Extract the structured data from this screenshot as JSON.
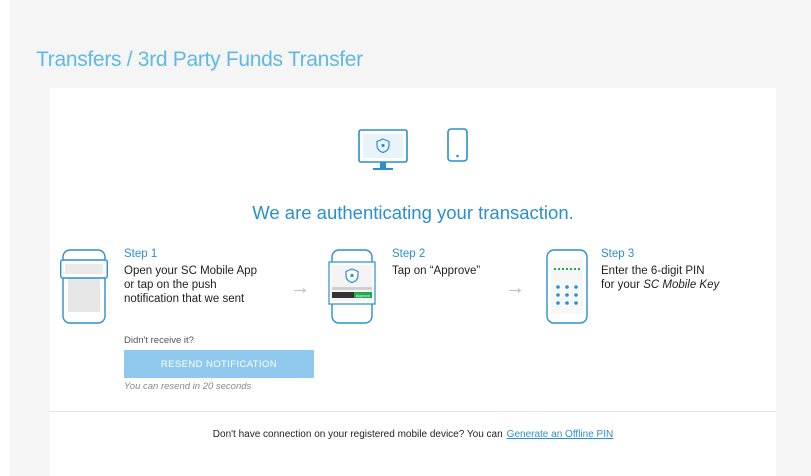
{
  "header": {
    "breadcrumb": "Transfers / 3rd Party Funds Transfer"
  },
  "auth": {
    "headline": "We are authenticating your transaction."
  },
  "steps": [
    {
      "title": "Step 1",
      "lines": [
        "Open your SC Mobile App",
        "or tap on the push",
        "notification that we sent"
      ],
      "icon": "mobile-notification-icon"
    },
    {
      "title": "Step 2",
      "lines": [
        "Tap on “Approve”"
      ],
      "icon": "mobile-approve-icon",
      "badge": "Approve"
    },
    {
      "title": "Step 3",
      "line1": "Enter the 6-digit PIN",
      "line2_prefix": "for your ",
      "line2_em": "SC Mobile Key",
      "icon": "mobile-pin-icon"
    }
  ],
  "resend": {
    "didnt_receive": "Didn't receive it?",
    "button_label": "RESEND NOTIFICATION",
    "note": "You can resend in 20 seconds"
  },
  "footer": {
    "text": "Don't have connection on your registered mobile device? You can",
    "link": "Generate an Offline PIN"
  },
  "colors": {
    "accent": "#2a8fd1",
    "breadcrumb": "#5fb8e6",
    "button": "#8fcaee",
    "approve_badge": "#1ea84f"
  }
}
